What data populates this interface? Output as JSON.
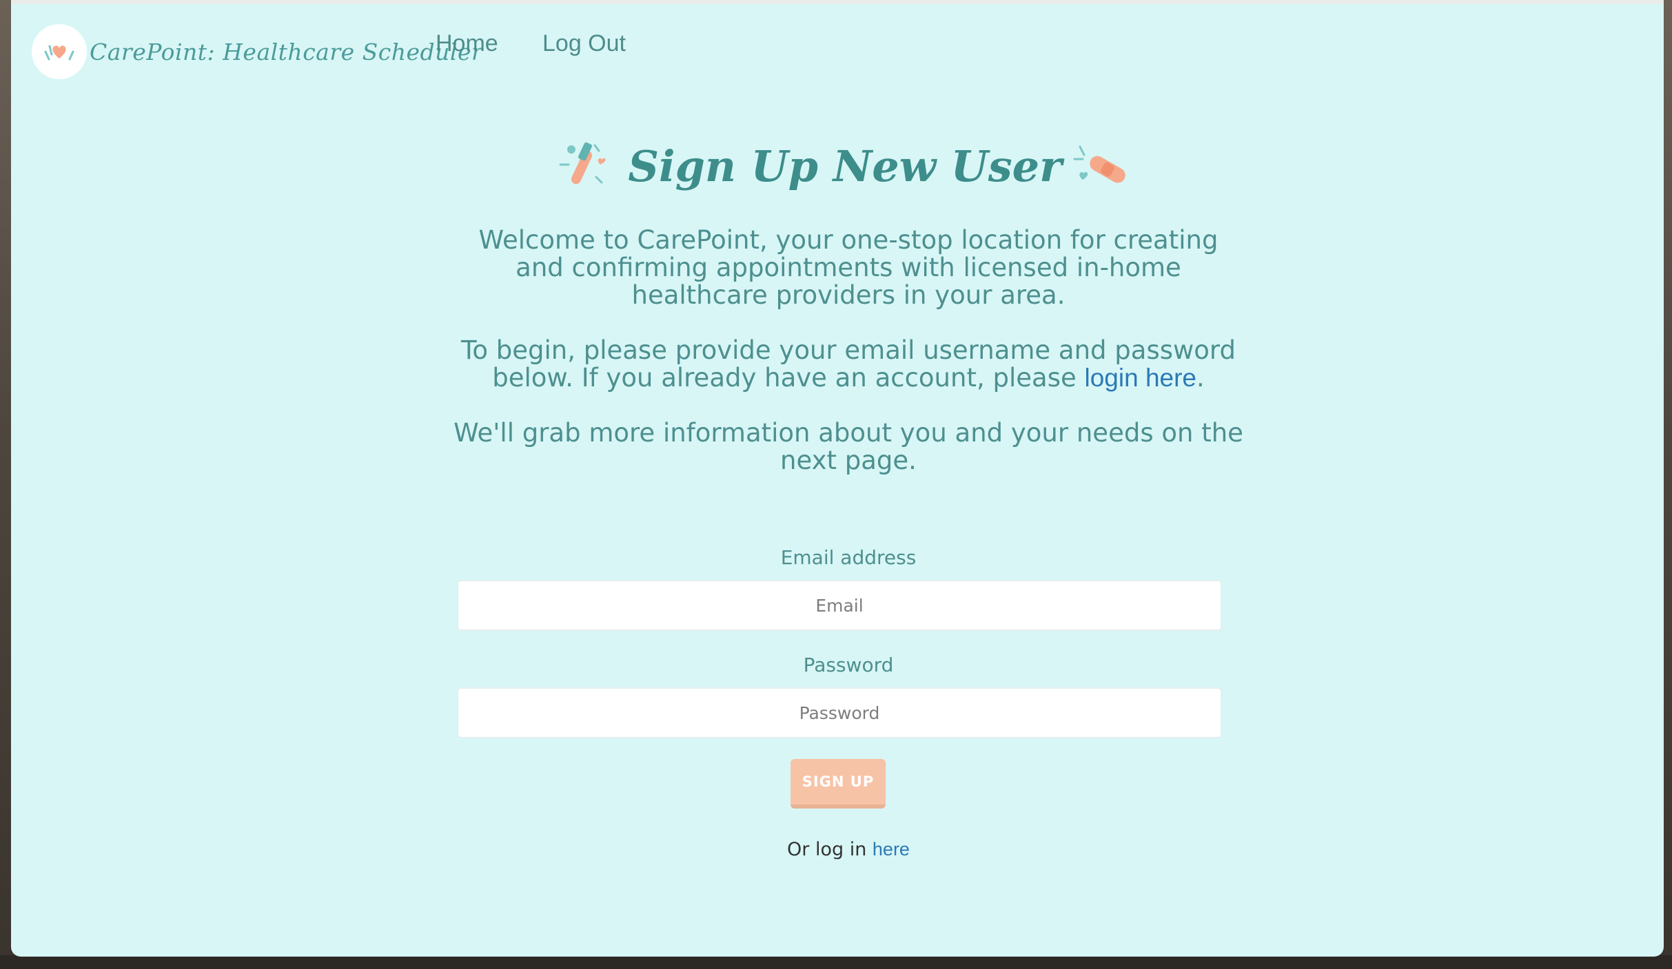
{
  "brand": {
    "name": "CarePoint: Healthcare Scheduler"
  },
  "nav": {
    "home": "Home",
    "logout": "Log Out"
  },
  "page": {
    "title": "Sign Up New User",
    "intro_1": "Welcome to CarePoint, your one-stop location for creating and confirming appointments with licensed in-home healthcare providers in your area.",
    "intro_2_before": "To begin, please provide your email username and password below. If you already have an account, please ",
    "intro_2_link": "login here",
    "intro_2_after": ".",
    "intro_3": "We'll grab more information about you and your needs on the next page."
  },
  "form": {
    "email_label": "Email address",
    "email_placeholder": "Email",
    "email_value": "",
    "password_label": "Password",
    "password_placeholder": "Password",
    "password_value": "",
    "submit_label": "SIGN UP",
    "login_prefix": "Or log in ",
    "login_link": "here"
  },
  "icons": {
    "logo": "heart-logo-icon",
    "title_left": "syringe-icon",
    "title_right": "bandage-icon"
  },
  "colors": {
    "background": "#d8f6f6",
    "teal_text": "#4e8f8f",
    "link": "#2b7ab6",
    "accent_peach": "#f7c3a7"
  }
}
